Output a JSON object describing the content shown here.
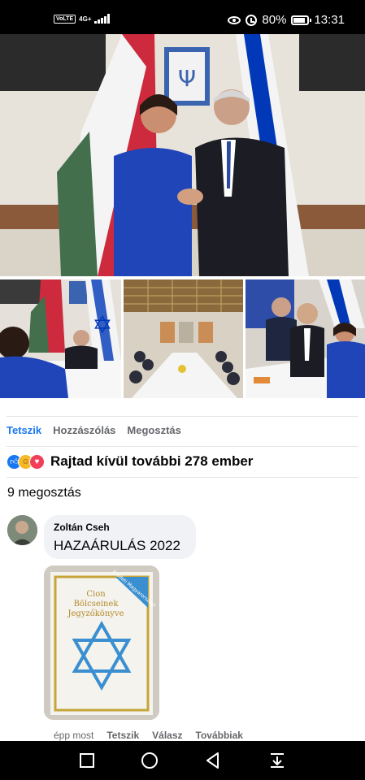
{
  "status_bar": {
    "volte": "VoLTE",
    "network": "4G+",
    "battery": "80%",
    "time": "13:31"
  },
  "post": {
    "actions": [
      "Tetszik",
      "Hozzászólás",
      "Megosztás"
    ],
    "reactions_text": "Rajtad kívül további 278 ember",
    "shares": "9 megosztás"
  },
  "comment": {
    "author": "Zoltán Cseh",
    "text": "HAZAÁRULÁS 2022",
    "image_text": {
      "title_line1": "Cion",
      "title_line2": "Bölcseinek",
      "title_line3": "Jegyzőkönyve",
      "ribbon": "Eredeti Magyarország!"
    },
    "meta": {
      "time": "épp most",
      "like": "Tetszik",
      "reply": "Válasz",
      "more": "Továbbiak"
    }
  },
  "colors": {
    "accent": "#1877f2",
    "flag_red": "#cd2a3e",
    "flag_green": "#436f4d",
    "flag_blue": "#0038b8",
    "suit_blue": "#1f45b8"
  }
}
